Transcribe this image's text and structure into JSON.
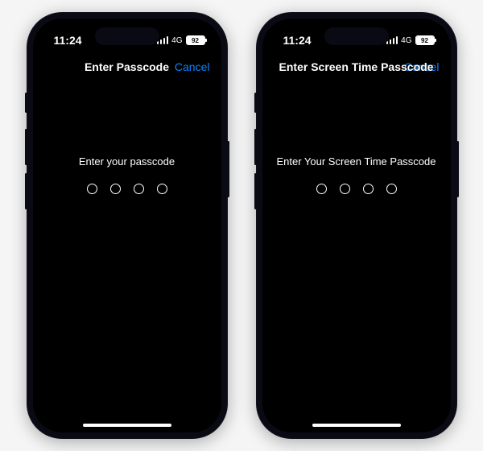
{
  "phones": [
    {
      "statusBar": {
        "time": "11:24",
        "network": "4G",
        "battery": "92"
      },
      "nav": {
        "title": "Enter Passcode",
        "cancel": "Cancel"
      },
      "content": {
        "prompt": "Enter your passcode",
        "digitCount": 4
      }
    },
    {
      "statusBar": {
        "time": "11:24",
        "network": "4G",
        "battery": "92"
      },
      "nav": {
        "title": "Enter Screen Time Passcode",
        "cancel": "Cancel"
      },
      "content": {
        "prompt": "Enter Your Screen Time Passcode",
        "digitCount": 4
      }
    }
  ]
}
